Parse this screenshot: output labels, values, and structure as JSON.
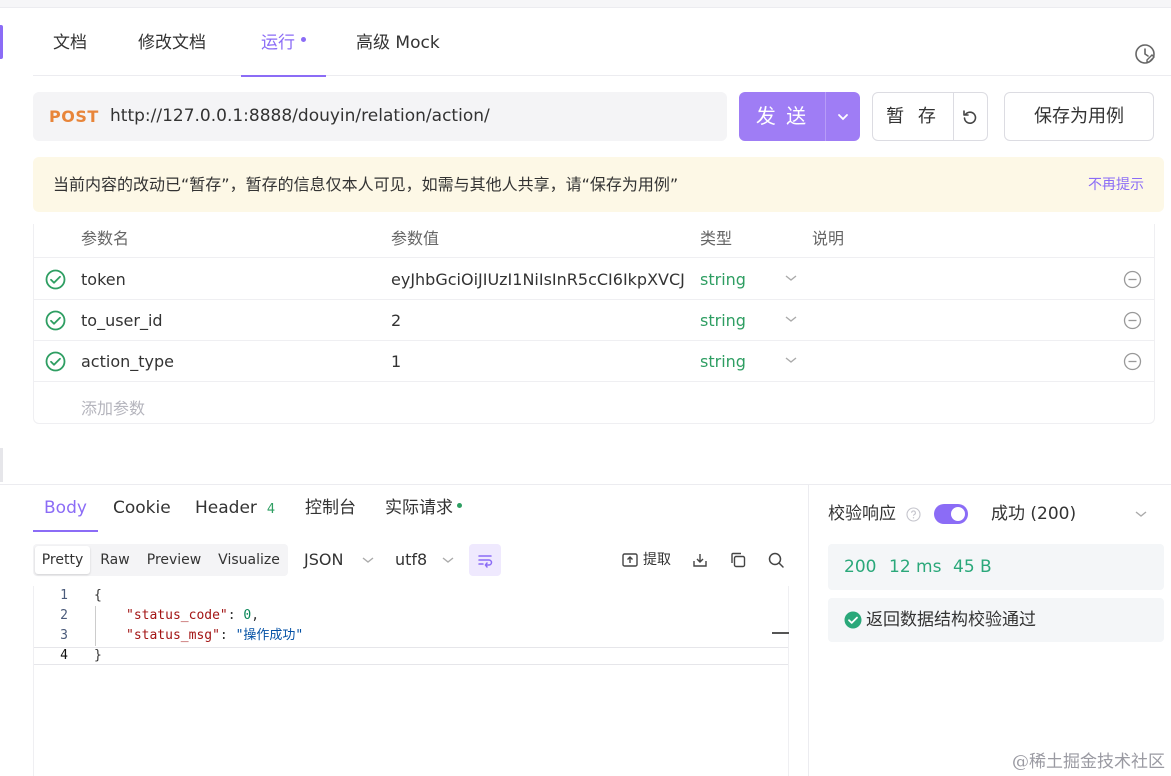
{
  "tabs": [
    {
      "label": "文档"
    },
    {
      "label": "修改文档"
    },
    {
      "label": "运行"
    },
    {
      "label": "高级 Mock"
    }
  ],
  "request": {
    "method": "POST",
    "url": "http://127.0.0.1:8888/douyin/relation/action/",
    "send_label": "发 送",
    "save_temp_label": "暂 存",
    "save_case_label": "保存为用例"
  },
  "notice": {
    "text": "当前内容的改动已“暂存”，暂存的信息仅本人可见，如需与其他人共享，请“保存为用例”",
    "dismiss": "不再提示"
  },
  "params": {
    "headers": [
      "参数名",
      "参数值",
      "类型",
      "说明"
    ],
    "rows": [
      {
        "name": "token",
        "value": "eyJhbGciOiJIUzI1NiIsInR5cCI6IkpXVCJ",
        "type": "string"
      },
      {
        "name": "to_user_id",
        "value": "2",
        "type": "string"
      },
      {
        "name": "action_type",
        "value": "1",
        "type": "string"
      }
    ],
    "add_placeholder": "添加参数"
  },
  "response_tabs": {
    "body": "Body",
    "cookie": "Cookie",
    "header": "Header",
    "header_count": "4",
    "console": "控制台",
    "actual": "实际请求"
  },
  "toolbar": {
    "views": [
      "Pretty",
      "Raw",
      "Preview",
      "Visualize"
    ],
    "format": "JSON",
    "encoding": "utf8",
    "extract": "提取"
  },
  "code": {
    "line_numbers": [
      "1",
      "2",
      "3",
      "4"
    ],
    "open": "{",
    "key1": "\"status_code\"",
    "val1": "0",
    "key2": "\"status_msg\"",
    "val2": "\"操作成功\"",
    "close": "}"
  },
  "validation": {
    "label": "校验响应",
    "enabled": true,
    "status": "成功 (200)",
    "metrics": {
      "code": "200",
      "time": "12 ms",
      "size": "45 B"
    },
    "result": "返回数据结构校验通过"
  },
  "watermark": "@稀土掘金技术社区",
  "colors": {
    "accent": "#8b6cf6",
    "send": "#9f7df5",
    "success": "#2e9e62",
    "method": "#e8853a"
  },
  "icons": [
    "history-icon",
    "chevron-down-icon",
    "reset-icon",
    "check-circle-icon",
    "minus-circle-icon",
    "wrap-icon",
    "extract-icon",
    "download-icon",
    "copy-icon",
    "search-icon",
    "help-icon"
  ]
}
